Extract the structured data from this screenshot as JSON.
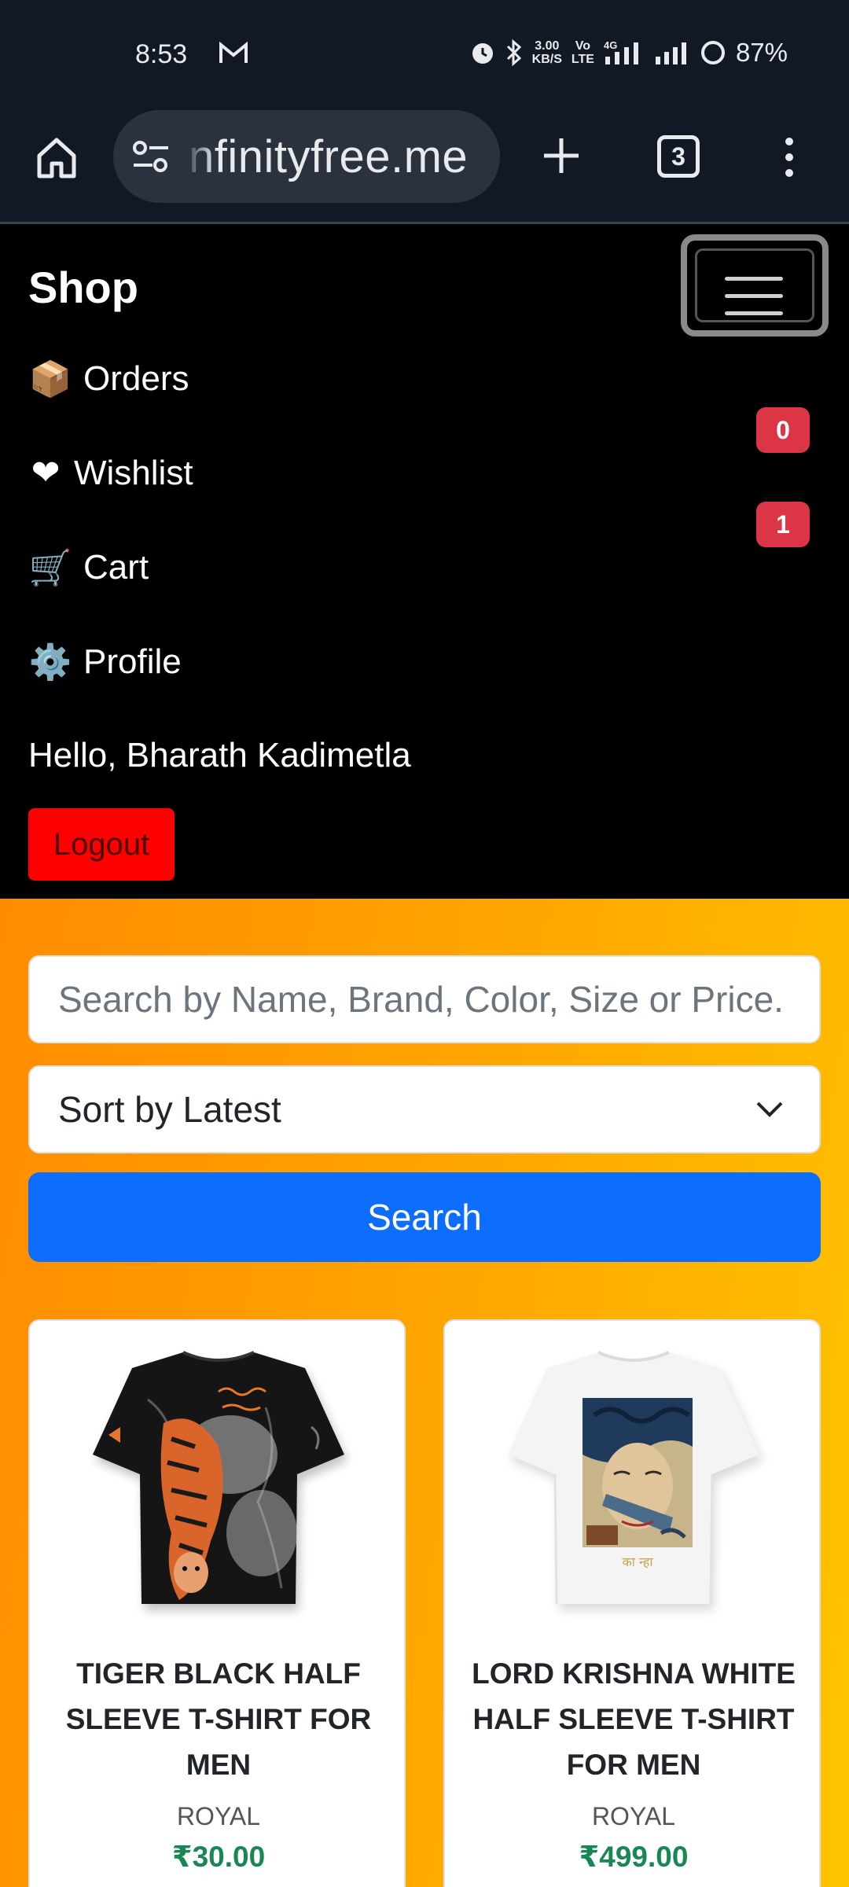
{
  "status_bar": {
    "time": "8:53",
    "net_speed_top": "3.00",
    "net_speed_bottom": "KB/S",
    "volte_top": "Vo",
    "volte_bottom": "LTE",
    "network": "4G",
    "battery": "87%"
  },
  "browser": {
    "url": "nfinityfree.me",
    "tab_count": "3"
  },
  "nav": {
    "brand": "Shop",
    "items": [
      {
        "icon": "📦",
        "label": "Orders"
      },
      {
        "icon": "❤",
        "label": "Wishlist"
      },
      {
        "icon": "🛒",
        "label": "Cart"
      },
      {
        "icon": "⚙️",
        "label": "Profile"
      }
    ],
    "wishlist_count": "0",
    "cart_count": "1",
    "greeting": "Hello, Bharath Kadimetla",
    "logout_label": "Logout"
  },
  "filters": {
    "search_placeholder": "Search by Name, Brand, Color, Size or Price.",
    "sort_selected": "Sort by Latest",
    "search_button": "Search"
  },
  "products": [
    {
      "title": "TIGER BLACK HALF SLEEVE T-SHIRT FOR MEN",
      "brand": "ROYAL",
      "price": "₹30.00",
      "image": "tiger-tshirt-image"
    },
    {
      "title": "LORD KRISHNA WHITE HALF SLEEVE T-SHIRT FOR MEN",
      "brand": "ROYAL",
      "price": "₹499.00",
      "image": "krishna-tshirt-image"
    }
  ],
  "colors": {
    "accent": "#0d6efd",
    "badge": "#dc3545",
    "logout": "#ff0000",
    "price": "#198754",
    "gradient_start": "#ff8c00",
    "gradient_end": "#ffc400"
  }
}
